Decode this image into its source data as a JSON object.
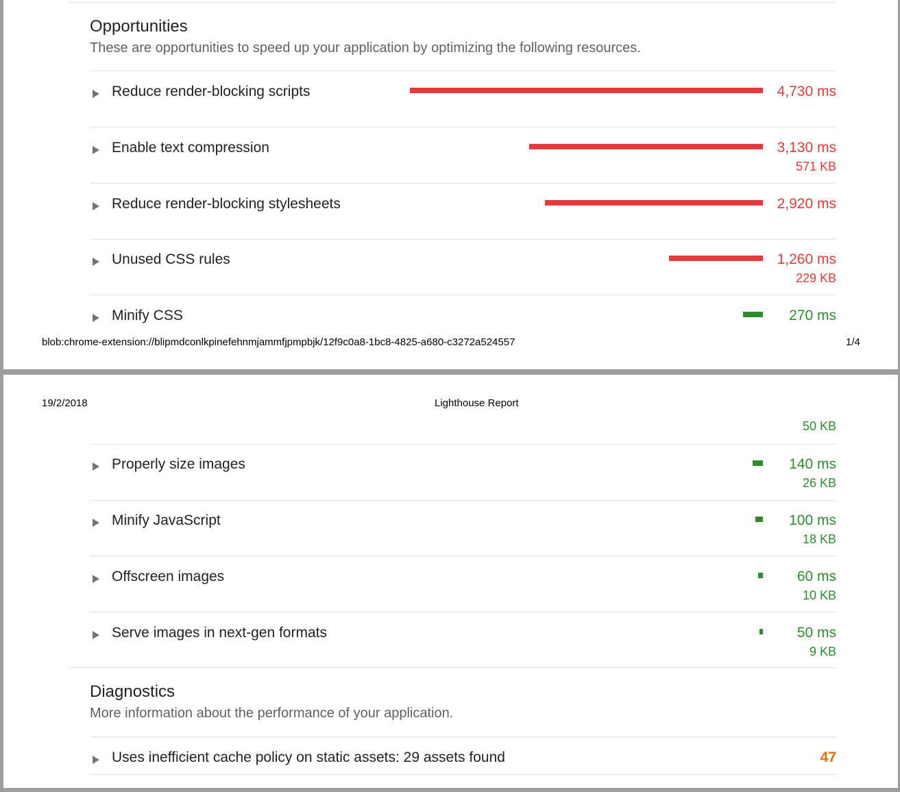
{
  "page1": {
    "opportunities_title": "Opportunities",
    "opportunities_desc": "These are opportunities to speed up your application by optimizing the following resources.",
    "items": [
      {
        "title": "Reduce render-blocking scripts",
        "ms": "4,730 ms",
        "kb": "",
        "savings_ms": 4730,
        "status": "red"
      },
      {
        "title": "Enable text compression",
        "ms": "3,130 ms",
        "kb": "571 KB",
        "savings_ms": 3130,
        "status": "red"
      },
      {
        "title": "Reduce render-blocking stylesheets",
        "ms": "2,920 ms",
        "kb": "",
        "savings_ms": 2920,
        "status": "red"
      },
      {
        "title": "Unused CSS rules",
        "ms": "1,260 ms",
        "kb": "229 KB",
        "savings_ms": 1260,
        "status": "red"
      },
      {
        "title": "Minify CSS",
        "ms": "270 ms",
        "kb": "",
        "savings_ms": 270,
        "status": "green"
      }
    ],
    "footer_url": "blob:chrome-extension://blipmdconlkpinefehnmjammfjpmpbjk/12f9c0a8-1bc8-4825-a680-c3272a524557",
    "footer_page": "1/4"
  },
  "page2": {
    "header_date": "19/2/2018",
    "header_title": "Lighthouse Report",
    "carry_kb": "50 KB",
    "items": [
      {
        "title": "Properly size images",
        "ms": "140 ms",
        "kb": "26 KB",
        "savings_ms": 140,
        "status": "green"
      },
      {
        "title": "Minify JavaScript",
        "ms": "100 ms",
        "kb": "18 KB",
        "savings_ms": 100,
        "status": "green"
      },
      {
        "title": "Offscreen images",
        "ms": "60 ms",
        "kb": "10 KB",
        "savings_ms": 60,
        "status": "green"
      },
      {
        "title": "Serve images in next-gen formats",
        "ms": "50 ms",
        "kb": "9 KB",
        "savings_ms": 50,
        "status": "green"
      }
    ],
    "diagnostics_title": "Diagnostics",
    "diagnostics_desc": "More information about the performance of your application.",
    "diagnostic": {
      "title": "Uses inefficient cache policy on static assets: 29 assets found",
      "value": "47"
    }
  },
  "colors": {
    "fail": "#e03c3c",
    "pass": "#2e8b2e",
    "average": "#ef6c00"
  }
}
